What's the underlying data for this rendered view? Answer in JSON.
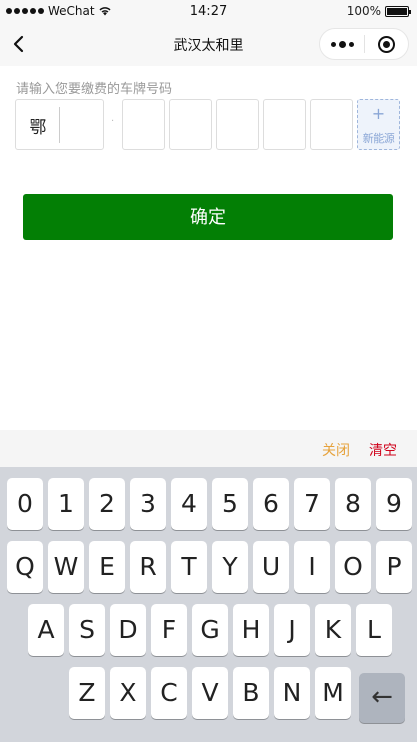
{
  "status_bar": {
    "carrier": "WeChat",
    "time": "14:27",
    "battery": "100%"
  },
  "nav": {
    "title": "武汉太和里"
  },
  "plate": {
    "hint": "请输入您要缴费的车牌号码",
    "province": "鄂",
    "separator": "·",
    "new_energy_plus": "+",
    "new_energy_label": "新能源"
  },
  "confirm_label": "确定",
  "keyboard_toolbar": {
    "close_label": "关闭",
    "clear_label": "清空"
  },
  "keyboard": {
    "row1": [
      "0",
      "1",
      "2",
      "3",
      "4",
      "5",
      "6",
      "7",
      "8",
      "9"
    ],
    "row2": [
      "Q",
      "W",
      "E",
      "R",
      "T",
      "Y",
      "U",
      "I",
      "O",
      "P"
    ],
    "row3": [
      "A",
      "S",
      "D",
      "F",
      "G",
      "H",
      "J",
      "K",
      "L"
    ],
    "row4": [
      "Z",
      "X",
      "C",
      "V",
      "B",
      "N",
      "M"
    ],
    "backspace": "←"
  }
}
